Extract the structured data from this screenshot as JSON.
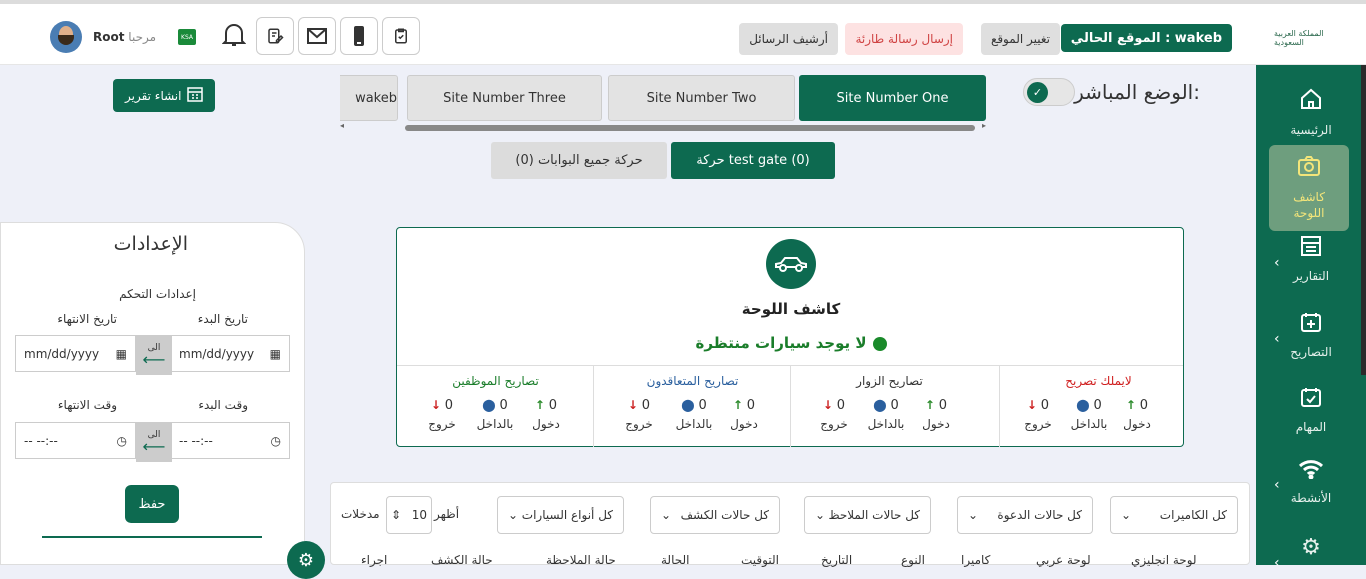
{
  "header": {
    "logo_text": "المملكة العربية السعودية",
    "current_site_label": "الموقع الحالي : wakeb",
    "change_site": "تغيير الموقع",
    "send_emergency": "إرسال رسالة طارئة",
    "archive_messages": "أرشيف الرسائل",
    "greeting": "مرحبا",
    "username": "Root",
    "flag_text": "KSA"
  },
  "sidebar": {
    "items": [
      {
        "label": "الرئيسية",
        "icon": "home-icon"
      },
      {
        "label": "كاشف اللوحة",
        "icon": "camera-icon"
      },
      {
        "label": "التقارير",
        "icon": "reports-icon"
      },
      {
        "label": "التصاريح",
        "icon": "permits-icon"
      },
      {
        "label": "المهام",
        "icon": "tasks-icon"
      },
      {
        "label": "الأنشطة",
        "icon": "wifi-icon"
      },
      {
        "label": "",
        "icon": "settings-icon"
      }
    ]
  },
  "live_mode": "الوضع المباشر:",
  "report_button": "انشاء تقرير",
  "site_tabs": [
    "Site Number One",
    "Site Number Two",
    "Site Number Three",
    "wakeb"
  ],
  "gates": {
    "active": "حركة test gate (0)",
    "all": "حركة جميع البوابات (0)"
  },
  "settings": {
    "title": "الإعدادات",
    "control": "إعدادات التحكم",
    "start_date": "تاريخ البدء",
    "end_date": "تاريخ الانتهاء",
    "date_placeholder": "mm/dd/yyyy",
    "to": "الى",
    "start_time": "وقت البدء",
    "end_time": "وقت الانتهاء",
    "time_placeholder": "-- --:--",
    "save": "حفظ"
  },
  "detector": {
    "title": "كاشف اللوحة",
    "status": "لا يوجد سيارات منتظرة",
    "columns": [
      {
        "title": "لايملك تصريح",
        "color": "#d02020",
        "in": "0",
        "inside": "0",
        "out": "0"
      },
      {
        "title": "تصاريح الزوار",
        "color": "#333333",
        "in": "0",
        "inside": "0",
        "out": "0"
      },
      {
        "title": "تصاريح المتعاقدون",
        "color": "#2a5f9e",
        "in": "0",
        "inside": "0",
        "out": "0"
      },
      {
        "title": "تصاريح الموظفين",
        "color": "#1a7d2a",
        "in": "0",
        "inside": "0",
        "out": "0"
      }
    ],
    "labels": {
      "in": "دخول",
      "inside": "بالداخل",
      "out": "خروج"
    }
  },
  "filters": {
    "cameras": "كل الكاميرات",
    "invitation": "كل حالات الدعوة",
    "notes": "كل حالات الملاحظ",
    "detection": "كل حالات الكشف",
    "car_types": "كل أنواع السيارات",
    "show": "أظهر",
    "entries": "مدخلات",
    "page_size": "10"
  },
  "table_headers": [
    "لوحة انجليزي",
    "لوحة عربي",
    "كاميرا",
    "النوع",
    "التاريخ",
    "التوقيت",
    "الحالة",
    "حالة الملاحظة",
    "حالة الكشف",
    "اجراء"
  ]
}
